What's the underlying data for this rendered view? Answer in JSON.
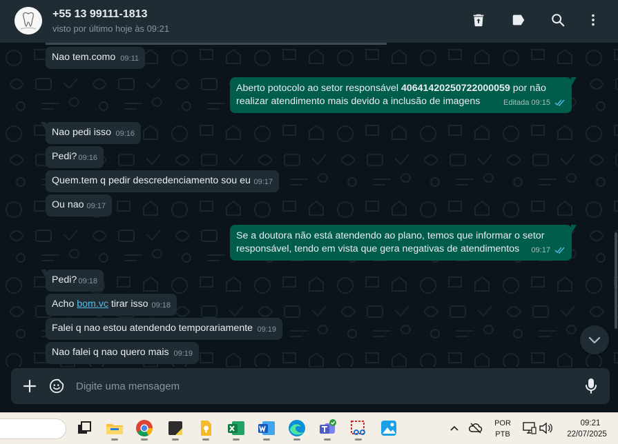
{
  "header": {
    "contact_name": "+55 13 99111-1813",
    "status": "visto por último hoje às 09:21",
    "icons": [
      "archive-icon",
      "label-icon",
      "search-icon",
      "menu-icon"
    ]
  },
  "messages": [
    {
      "direction": "in",
      "text": "Nao tem.como",
      "time": "09:11"
    },
    {
      "direction": "out",
      "text_before": "Aberto potocolo ao setor responsável ",
      "bold": "40641420250722000059",
      "text_after": " por não realizar atendimento mais devido a inclusão de imagens",
      "edited_label": "Editada",
      "time": "09:15"
    },
    {
      "direction": "in",
      "text": "Nao pedi isso",
      "time": "09:16"
    },
    {
      "direction": "in",
      "text": "Pedi?",
      "time": "09:16"
    },
    {
      "direction": "in",
      "text": "Quem.tem q pedir descredenciamento sou eu",
      "time": "09:17"
    },
    {
      "direction": "in",
      "text": "Ou nao",
      "time": "09:17"
    },
    {
      "direction": "out",
      "text": "Se a doutora não está atendendo ao plano, temos que informar o setor responsável, tendo em vista que gera negativas de atendimentos",
      "time": "09:17"
    },
    {
      "direction": "in",
      "text": "Pedi?",
      "time": "09:18"
    },
    {
      "direction": "in",
      "text_before": "Acho ",
      "link": "bom.vc",
      "text_after": " tirar isso",
      "time": "09:18"
    },
    {
      "direction": "in",
      "text": "Falei q nao estou atendendo temporariamente",
      "time": "09:19"
    },
    {
      "direction": "in",
      "text": "Nao falei q nao quero mais",
      "time": "09:19"
    }
  ],
  "composer": {
    "placeholder": "Digite uma mensagem"
  },
  "taskbar": {
    "apps": [
      "task-view",
      "file-explorer",
      "chrome",
      "sticky-notes",
      "keep",
      "excel",
      "word",
      "edge",
      "teams",
      "snipping-tool",
      "photos"
    ],
    "language_top": "POR",
    "language_bottom": "PTB",
    "clock_time": "09:21",
    "clock_date": "22/07/2025"
  },
  "colors": {
    "header_bg": "#202c33",
    "chat_bg": "#0b141a",
    "incoming_bubble": "#202c33",
    "outgoing_bubble": "#005c4b",
    "read_ticks": "#53bdeb",
    "link": "#53bdeb"
  }
}
